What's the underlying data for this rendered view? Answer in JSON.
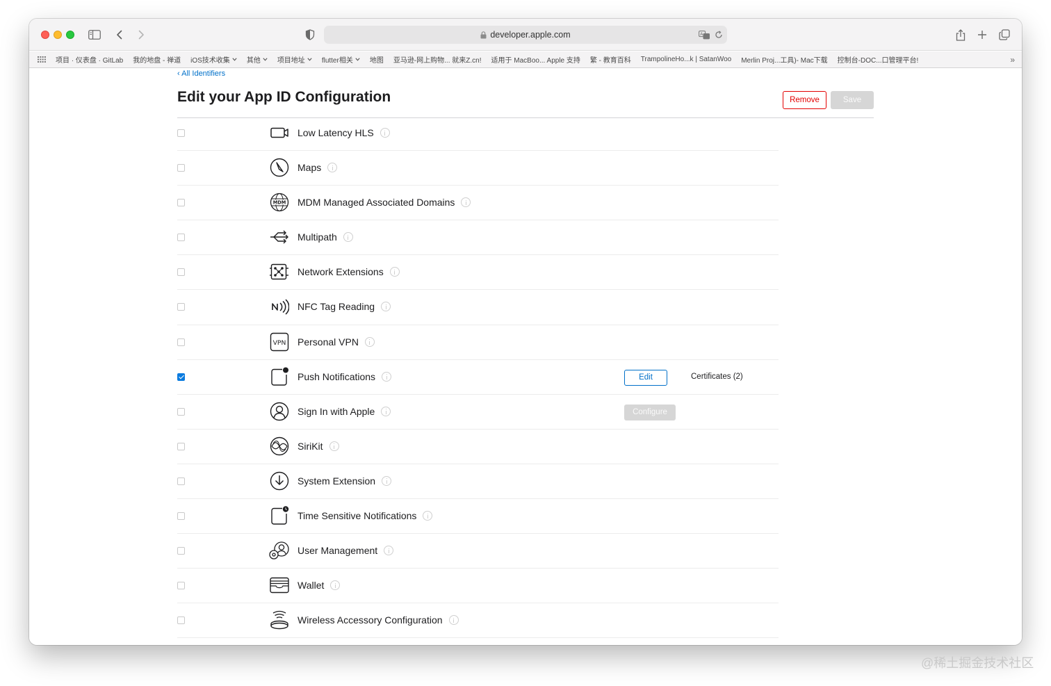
{
  "browser": {
    "url": "developer.apple.com",
    "favorites": [
      {
        "label": "项目 · 仪表盘 · GitLab",
        "chevron": false
      },
      {
        "label": "我的地盘 - 禅道",
        "chevron": false
      },
      {
        "label": "iOS技术收集",
        "chevron": true
      },
      {
        "label": "其他",
        "chevron": true
      },
      {
        "label": "项目地址",
        "chevron": true
      },
      {
        "label": "flutter相关",
        "chevron": true
      },
      {
        "label": "地图",
        "chevron": false
      },
      {
        "label": "亚马逊-网上购物... 就来Z.cn!",
        "chevron": false
      },
      {
        "label": "适用于 MacBoo... Apple 支持",
        "chevron": false
      },
      {
        "label": "繁 - 教育百科",
        "chevron": false
      },
      {
        "label": "TrampolineHo...k | SatanWoo",
        "chevron": false
      },
      {
        "label": "Merlin Proj...工具)- Mac下载",
        "chevron": false
      },
      {
        "label": "控制台-DOC...口管理平台!",
        "chevron": false
      }
    ],
    "more_symbol": "»"
  },
  "page": {
    "back_link": "‹ All Identifiers",
    "title": "Edit your App ID Configuration",
    "remove_label": "Remove",
    "save_label": "Save"
  },
  "capabilities": [
    {
      "name": "Low Latency HLS",
      "checked": false,
      "icon": "video-camera-icon"
    },
    {
      "name": "Maps",
      "checked": false,
      "icon": "compass-icon"
    },
    {
      "name": "MDM Managed Associated Domains",
      "checked": false,
      "icon": "mdm-globe-icon"
    },
    {
      "name": "Multipath",
      "checked": false,
      "icon": "multipath-arrows-icon"
    },
    {
      "name": "Network Extensions",
      "checked": false,
      "icon": "network-extensions-icon"
    },
    {
      "name": "NFC Tag Reading",
      "checked": false,
      "icon": "nfc-icon"
    },
    {
      "name": "Personal VPN",
      "checked": false,
      "icon": "vpn-icon"
    },
    {
      "name": "Push Notifications",
      "checked": true,
      "icon": "push-notification-icon",
      "action": "Edit",
      "extra": "Certificates (2)"
    },
    {
      "name": "Sign In with Apple",
      "checked": false,
      "icon": "person-icon",
      "action_disabled": "Configure"
    },
    {
      "name": "SiriKit",
      "checked": false,
      "icon": "siri-icon"
    },
    {
      "name": "System Extension",
      "checked": false,
      "icon": "download-circle-icon"
    },
    {
      "name": "Time Sensitive Notifications",
      "checked": false,
      "icon": "time-notification-icon"
    },
    {
      "name": "User Management",
      "checked": false,
      "icon": "user-management-icon"
    },
    {
      "name": "Wallet",
      "checked": false,
      "icon": "wallet-icon"
    },
    {
      "name": "Wireless Accessory Configuration",
      "checked": false,
      "icon": "wireless-accessory-icon"
    }
  ],
  "watermark": "@稀土掘金技术社区"
}
